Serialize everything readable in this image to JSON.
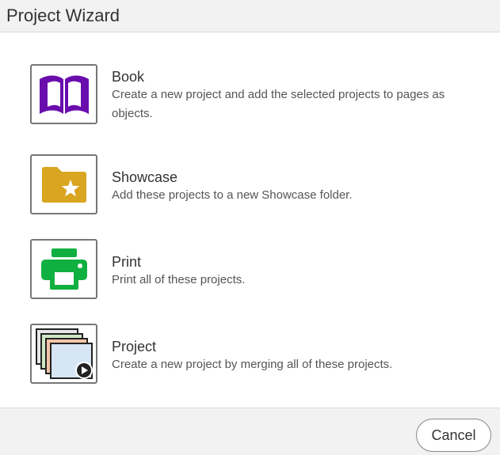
{
  "header": {
    "title": "Project Wizard"
  },
  "options": [
    {
      "icon": "book-icon",
      "title": "Book",
      "description": "Create a new project and add the selected projects to pages as objects.",
      "color": "#6a0dad"
    },
    {
      "icon": "showcase-folder-star-icon",
      "title": "Showcase",
      "description": "Add these projects to a new Showcase folder.",
      "color": "#daa520"
    },
    {
      "icon": "printer-icon",
      "title": "Print",
      "description": "Print all of these projects.",
      "color": "#10b040"
    },
    {
      "icon": "stacked-slides-play-icon",
      "title": "Project",
      "description": "Create a new project by merging all of these projects.",
      "color": "#1f1f1f"
    }
  ],
  "footer": {
    "cancel_label": "Cancel"
  }
}
